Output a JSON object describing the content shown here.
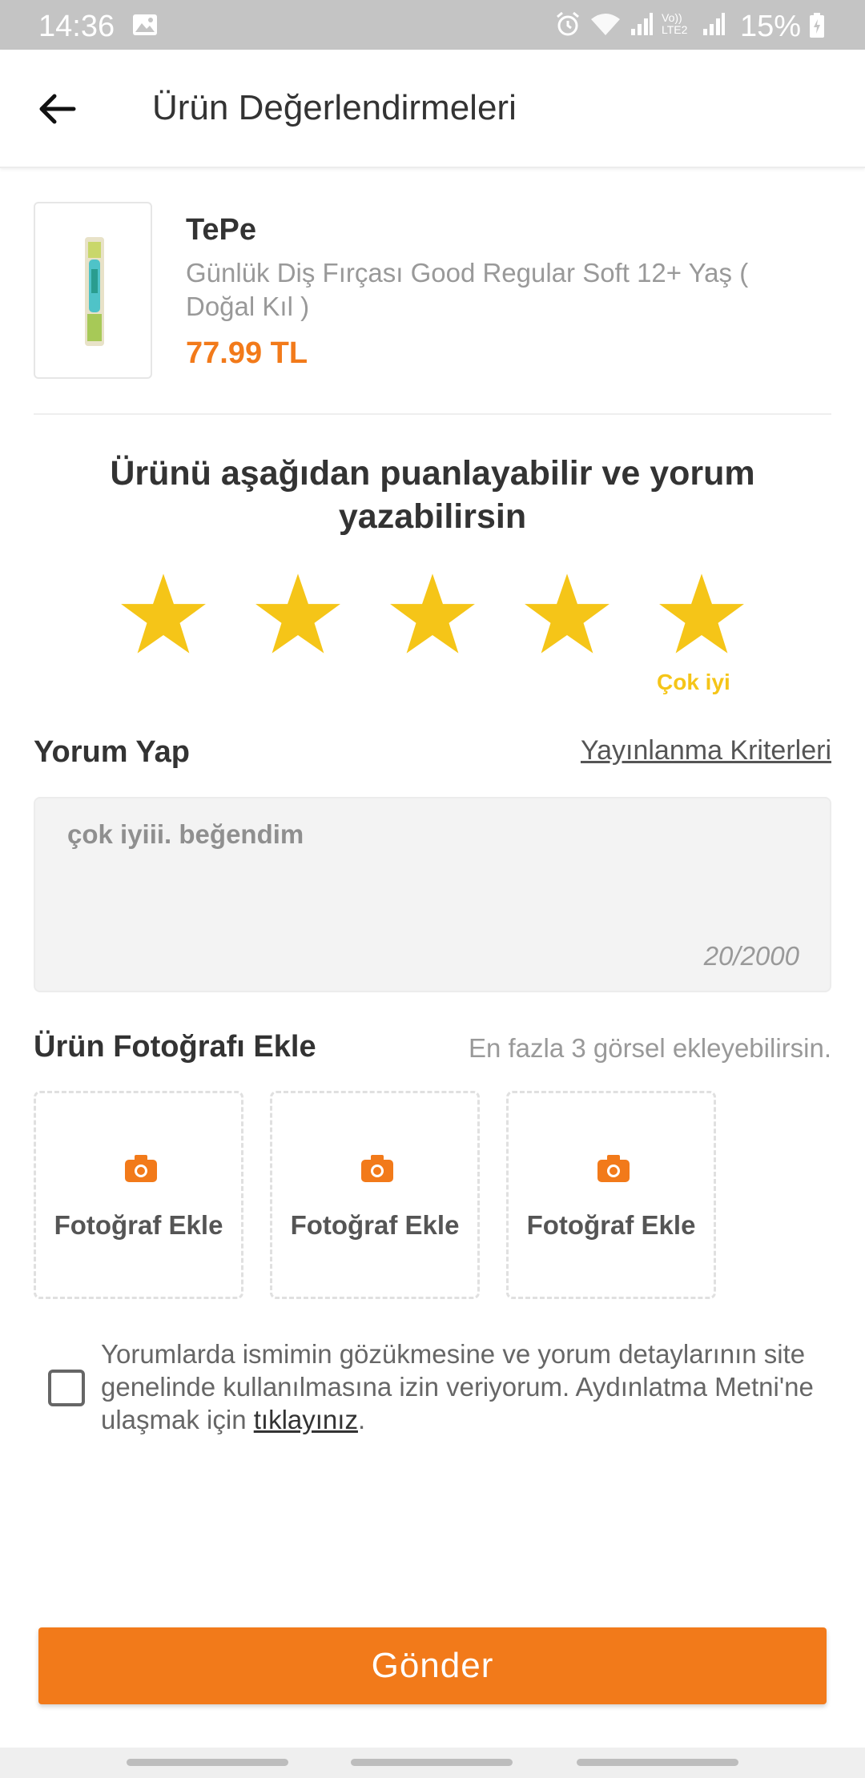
{
  "status_bar": {
    "time": "14:36",
    "battery": "15%",
    "network_label": "Vo)) LTE2"
  },
  "app_bar": {
    "title": "Ürün Değerlendirmeleri",
    "back_icon": "arrow-left-icon"
  },
  "product": {
    "brand": "TePe",
    "name": "Günlük Diş Fırçası Good Regular Soft 12+ Yaş ( Doğal Kıl )",
    "price": "77.99 TL"
  },
  "rating": {
    "title": "Ürünü aşağıdan puanlayabilir ve yorum yazabilirsin",
    "value": 5,
    "max": 5,
    "label": "Çok iyi",
    "star_color": "#f5c518"
  },
  "comment": {
    "heading": "Yorum Yap",
    "criteria_link": "Yayınlanma Kriterleri",
    "value": "çok iyiii. beğendim",
    "counter": "20/2000"
  },
  "photos": {
    "heading": "Ürün Fotoğrafı Ekle",
    "hint": "En fazla 3 görsel ekleyebilirsin.",
    "slots": [
      {
        "label": "Fotoğraf Ekle",
        "icon": "camera-icon"
      },
      {
        "label": "Fotoğraf Ekle",
        "icon": "camera-icon"
      },
      {
        "label": "Fotoğraf Ekle",
        "icon": "camera-icon"
      }
    ]
  },
  "consent": {
    "checked": false,
    "text": "Yorumlarda ismimin gözükmesine ve yorum detaylarının site genelinde kullanılmasına izin veriyorum. Aydınlatma Metni'ne ulaşmak için ",
    "link": "tıklayınız",
    "suffix": "."
  },
  "submit_label": "Gönder",
  "colors": {
    "accent": "#f27a1a",
    "star": "#f5c518",
    "status_bar": "#c4c4c4"
  }
}
